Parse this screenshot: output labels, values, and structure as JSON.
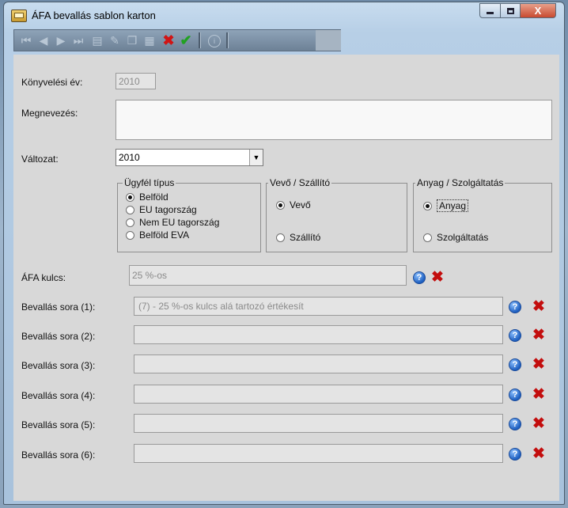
{
  "window": {
    "title": "ÁFA bevallás sablon karton",
    "close_glyph": "X"
  },
  "toolbar": {
    "icons": [
      "first-icon",
      "prev-icon",
      "next-icon",
      "last-icon",
      "new-record-icon",
      "edit-record-icon",
      "copy-record-icon",
      "paste-record-icon",
      "cancel-icon",
      "save-icon",
      "info-icon"
    ],
    "cancel_glyph": "✖",
    "save_glyph": "✔",
    "info_glyph": "i"
  },
  "form": {
    "konyvelesi_ev": {
      "label": "Könyvelési év:",
      "value": "2010"
    },
    "megnevezes": {
      "label": "Megnevezés:",
      "value": ""
    },
    "valtozat": {
      "label": "Változat:",
      "value": "2010"
    },
    "ugyfel_tipus": {
      "title": "Ügyfél típus",
      "options": [
        "Belföld",
        "EU tagország",
        "Nem EU tagország",
        "Belföld EVA"
      ],
      "selected": "Belföld"
    },
    "vevo_szallito": {
      "title": "Vevő / Szállító",
      "options": [
        "Vevő",
        "Szállító"
      ],
      "selected": "Vevő"
    },
    "anyag_szolgaltatas": {
      "title": "Anyag / Szolgáltatás",
      "options": [
        "Anyag",
        "Szolgáltatás"
      ],
      "selected": "Anyag"
    },
    "afa_kulcs": {
      "label": "ÁFA kulcs:",
      "value": "25 %-os"
    },
    "bevallas_sorok": [
      {
        "label": "Bevallás sora (1):",
        "value": "(7) - 25 %-os kulcs alá tartozó értékesít"
      },
      {
        "label": "Bevallás sora (2):",
        "value": ""
      },
      {
        "label": "Bevallás sora (3):",
        "value": ""
      },
      {
        "label": "Bevallás sora (4):",
        "value": ""
      },
      {
        "label": "Bevallás sora (5):",
        "value": ""
      },
      {
        "label": "Bevallás sora (6):",
        "value": ""
      }
    ],
    "help_glyph": "?",
    "delete_glyph": "✖"
  }
}
